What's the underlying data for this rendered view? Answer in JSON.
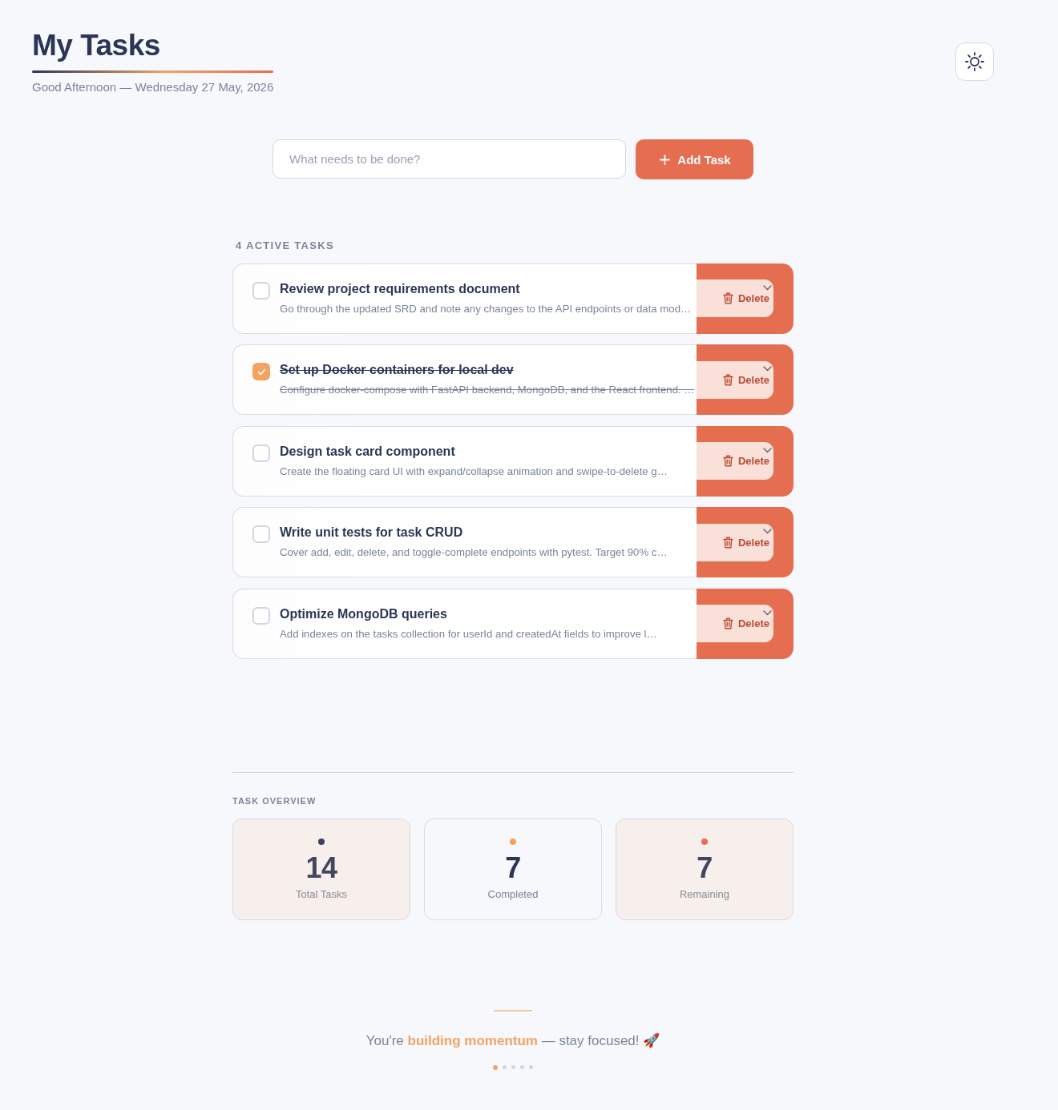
{
  "header": {
    "title": "My Tasks",
    "subtitle": "Good Afternoon — Wednesday 27 May, 2026"
  },
  "composer": {
    "placeholder": "What needs to be done?",
    "button": "Add Task"
  },
  "active_tasks": {
    "heading": "4 ACTIVE TASKS",
    "tasks": [
      {
        "title": "Review project requirements document",
        "description": "Go through the updated SRD and note any changes to the API endpoints or data mod…",
        "checked": false,
        "delete_label": "Delete"
      },
      {
        "title": "Set up Docker containers for local dev",
        "description": "Configure docker-compose with FastAPI backend, MongoDB, and the React frontend. …",
        "checked": true,
        "delete_label": "Delete"
      },
      {
        "title": "Design task card component",
        "description": "Create the floating card UI with expand/collapse animation and swipe-to-delete g…",
        "checked": false,
        "delete_label": "Delete"
      },
      {
        "title": "Write unit tests for task CRUD",
        "description": "Cover add, edit, delete, and toggle-complete endpoints with pytest. Target 90% c…",
        "checked": false,
        "delete_label": "Delete"
      },
      {
        "title": "Optimize MongoDB queries",
        "description": "Add indexes on the tasks collection for userId and createdAt fields to improve l…",
        "checked": false,
        "delete_label": "Delete"
      }
    ]
  },
  "overview": {
    "heading": "TASK OVERVIEW",
    "stats": [
      {
        "value": "14",
        "label": "Total Tasks",
        "color": "#3d4060",
        "kind": "tinted"
      },
      {
        "value": "7",
        "label": "Completed",
        "color": "#f4a261",
        "kind": "plain"
      },
      {
        "value": "7",
        "label": "Remaining",
        "color": "#e76f51",
        "kind": "tinted"
      }
    ]
  },
  "footer": {
    "quote": "You're **building momentum** — stay focused! 🚀",
    "dots": [
      {
        "selected": true
      },
      {
        "selected": false
      },
      {
        "selected": false
      },
      {
        "selected": false
      },
      {
        "selected": false
      }
    ]
  }
}
